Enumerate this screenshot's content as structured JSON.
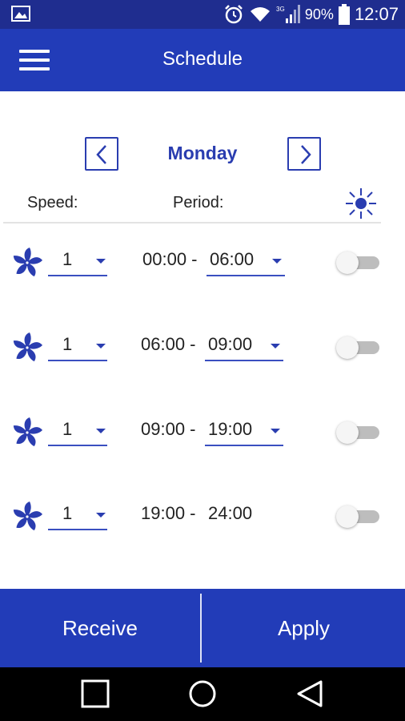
{
  "status_bar": {
    "battery": "90%",
    "time": "12:07",
    "network": "3G",
    "icons": [
      "gallery-icon",
      "alarm-icon",
      "wifi-icon",
      "signal-icon",
      "battery-icon"
    ]
  },
  "app_bar": {
    "title": "Schedule",
    "menu_icon": "hamburger-menu-icon"
  },
  "day_nav": {
    "day": "Monday",
    "prev_icon": "chevron-left-icon",
    "next_icon": "chevron-right-icon"
  },
  "headers": {
    "speed": "Speed:",
    "period": "Period:",
    "mode_icon": "sun-icon"
  },
  "rows": [
    {
      "speed": "1",
      "start": "00:00 - ",
      "end": "06:00",
      "end_editable": true,
      "enabled": false
    },
    {
      "speed": "1",
      "start": "06:00 - ",
      "end": "09:00",
      "end_editable": true,
      "enabled": false
    },
    {
      "speed": "1",
      "start": "09:00 - ",
      "end": "19:00",
      "end_editable": true,
      "enabled": false
    },
    {
      "speed": "1",
      "start": "19:00 - ",
      "end": "24:00",
      "end_editable": false,
      "enabled": false
    }
  ],
  "actions": {
    "receive": "Receive",
    "apply": "Apply"
  },
  "system_nav": {
    "icons": [
      "recents-square-icon",
      "home-circle-icon",
      "back-triangle-icon"
    ]
  },
  "colors": {
    "primary": "#223cb8",
    "status_bar": "#1f2d8f",
    "accent": "#2a3db0"
  }
}
